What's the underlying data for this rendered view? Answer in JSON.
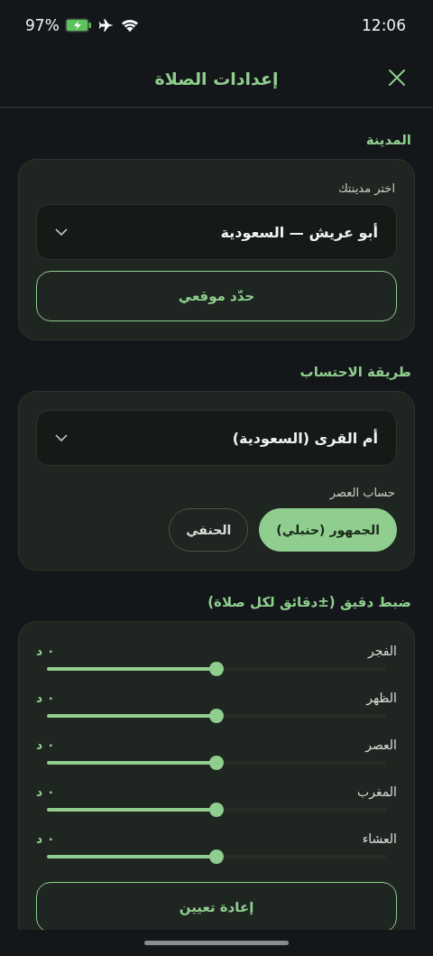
{
  "status_bar": {
    "battery": "97%",
    "time": "12:06"
  },
  "header": {
    "title": "إعدادات الصلاة"
  },
  "city_section": {
    "title": "المدينة",
    "field_label": "اختر مدينتك",
    "city": "أبو عريش — السعودية",
    "locate_button": "حدّد موقعي"
  },
  "method_section": {
    "title": "طريقة الاحتساب",
    "method": "أم القرى (السعودية)",
    "asr_label": "حساب العصر",
    "asr_options": [
      {
        "label": "الجمهور (حنبلي)",
        "selected": true
      },
      {
        "label": "الحنفي",
        "selected": false
      }
    ]
  },
  "adjust_section": {
    "title": "ضبط دقيق (±دقائق لكل صلاة)",
    "prayers": [
      {
        "name": "الفجر",
        "reading": "٠ د",
        "level": 0.5
      },
      {
        "name": "الظهر",
        "reading": "٠ د",
        "level": 0.5
      },
      {
        "name": "العصر",
        "reading": "٠ د",
        "level": 0.5
      },
      {
        "name": "المغرب",
        "reading": "٠ د",
        "level": 0.5
      },
      {
        "name": "العشاء",
        "reading": "٠ د",
        "level": 0.5
      }
    ],
    "reset_button": "إعادة تعيين"
  }
}
